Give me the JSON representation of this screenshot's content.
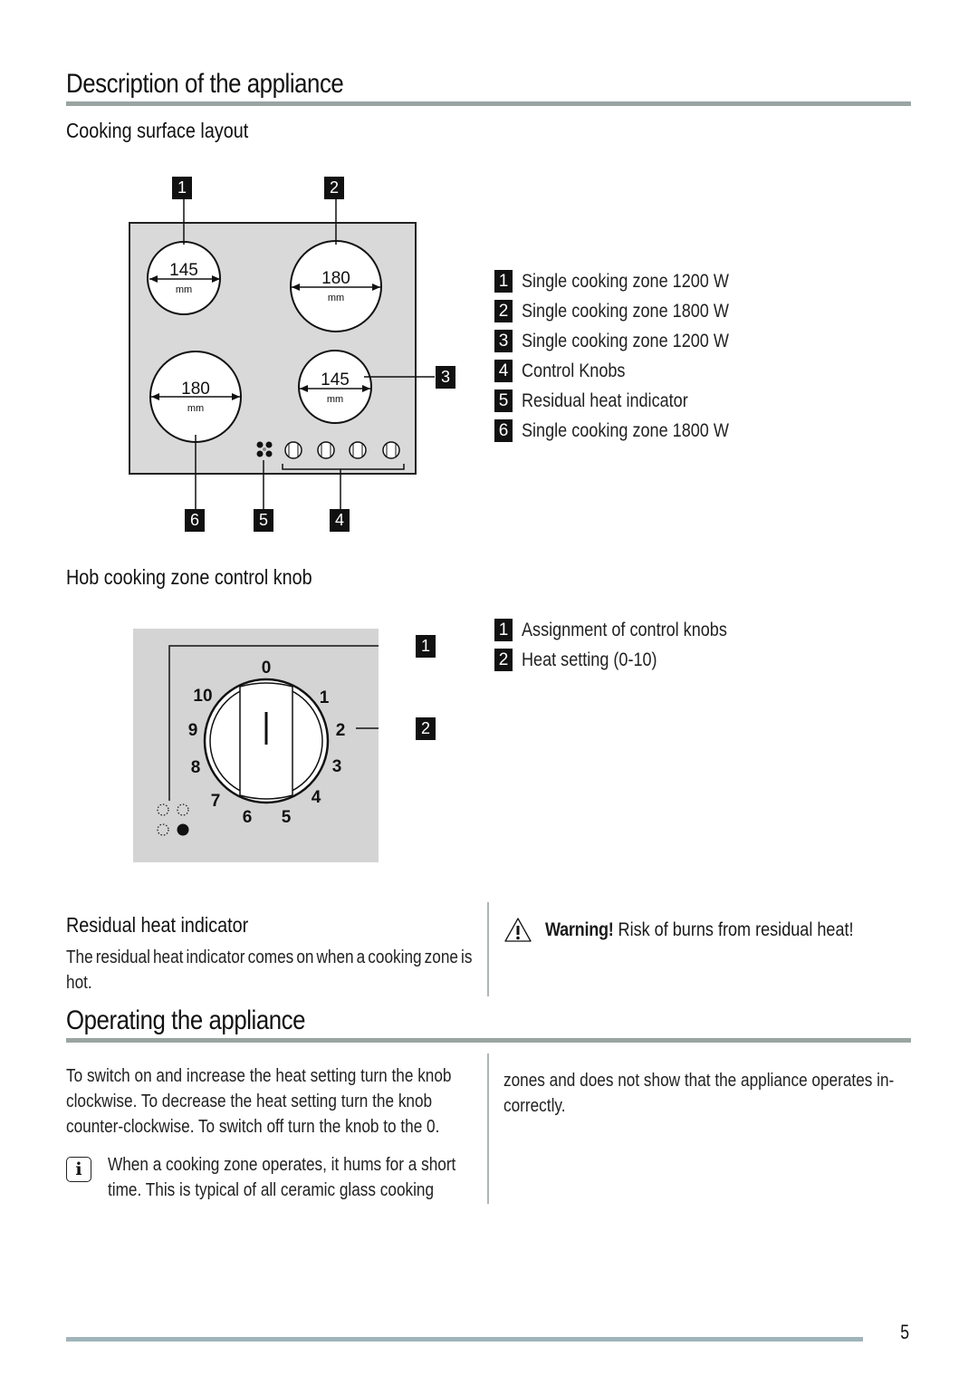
{
  "page": {
    "title": "Description of the appliance",
    "page_number": "5"
  },
  "cooking_surface": {
    "heading": "Cooking surface layout",
    "zones": [
      {
        "label": "1",
        "diameter": "145",
        "unit": "mm"
      },
      {
        "label": "2",
        "diameter": "180",
        "unit": "mm"
      },
      {
        "label": "3",
        "diameter": "145",
        "unit": "mm"
      },
      {
        "label": "6",
        "diameter": "180",
        "unit": "mm"
      }
    ],
    "callouts": [
      "1",
      "2",
      "3",
      "4",
      "5",
      "6"
    ],
    "legend": [
      {
        "num": "1",
        "text": "Single cooking zone 1200 W"
      },
      {
        "num": "2",
        "text": "Single cooking zone 1800 W"
      },
      {
        "num": "3",
        "text": "Single cooking zone 1200 W"
      },
      {
        "num": "4",
        "text": "Control Knobs"
      },
      {
        "num": "5",
        "text": "Residual heat indicator"
      },
      {
        "num": "6",
        "text": "Single cooking zone 1800 W"
      }
    ]
  },
  "knob": {
    "heading": "Hob cooking zone control knob",
    "scale": [
      "0",
      "1",
      "2",
      "3",
      "4",
      "5",
      "6",
      "7",
      "8",
      "9",
      "10"
    ],
    "callouts": [
      "1",
      "2"
    ],
    "legend": [
      {
        "num": "1",
        "text": "Assignment of control knobs"
      },
      {
        "num": "2",
        "text": "Heat setting (0-10)"
      }
    ]
  },
  "residual_heat": {
    "heading": "Residual heat indicator",
    "text": "The residual heat indicator comes on when a cooking zone is hot.",
    "warning_label": "Warning!",
    "warning_text": "Risk of burns from residual heat!",
    "warning_icon": "warning-triangle-icon"
  },
  "operating": {
    "title": "Operating the appliance",
    "text": "To switch on and increase the heat setting turn the knob clockwise. To decrease the heat setting turn the knob counter-clockwise. To switch off turn the knob to the 0.",
    "info_icon": "info-icon",
    "info_text_left": "When a cooking zone operates, it hums for a short time. This is typical of all ceramic glass cooking",
    "info_text_right": "zones and does not show that the appliance operates in-correctly."
  }
}
